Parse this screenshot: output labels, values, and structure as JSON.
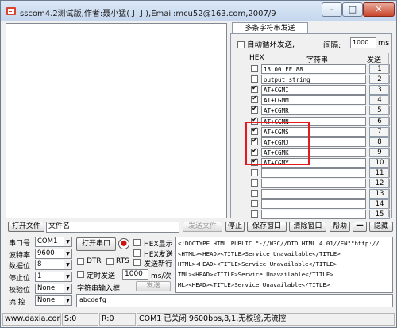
{
  "window": {
    "title": "sscom4.2测试版,作者:聂小猛(丁丁),Email:mcu52@163.com,2007/9",
    "minimize_glyph": "–",
    "maximize_glyph": "□",
    "close_glyph": "✕"
  },
  "multi_send": {
    "tab_label": "多条字符串发送",
    "auto_loop_label": "自动循环发送,",
    "interval_label": "间隔:",
    "interval_value": "1000",
    "interval_unit": "ms",
    "header_hex": "HEX",
    "header_string": "字符串",
    "header_send": "发送",
    "rows": [
      {
        "checked": false,
        "text": "13 00 FF 88",
        "num": "1"
      },
      {
        "checked": false,
        "text": "output string",
        "num": "2"
      },
      {
        "checked": true,
        "text": "AT+CGMI",
        "num": "3"
      },
      {
        "checked": true,
        "text": "AT+CGMM",
        "num": "4"
      },
      {
        "checked": true,
        "text": "AT+CGMR",
        "num": "5"
      },
      {
        "checked": true,
        "text": "AT+CGMN",
        "num": "6"
      },
      {
        "checked": true,
        "text": "AT+CGMS",
        "num": "7"
      },
      {
        "checked": true,
        "text": "AT+CGMJ",
        "num": "8"
      },
      {
        "checked": true,
        "text": "AT+CGMK",
        "num": "9"
      },
      {
        "checked": true,
        "text": "AT+CGMY",
        "num": "10"
      },
      {
        "checked": false,
        "text": "",
        "num": "11"
      },
      {
        "checked": false,
        "text": "",
        "num": "12"
      },
      {
        "checked": false,
        "text": "",
        "num": "13"
      },
      {
        "checked": false,
        "text": "",
        "num": "14"
      },
      {
        "checked": false,
        "text": "",
        "num": "15"
      }
    ]
  },
  "toolbar": {
    "open_file": "打开文件",
    "filename": "文件名",
    "send_file": "发送文件",
    "stop": "停止",
    "save_window": "保存窗口",
    "clear_window": "清除窗口",
    "help": "帮助",
    "dash": "一",
    "hide": "隐藏"
  },
  "port": {
    "port_label": "串口号",
    "port_value": "COM1",
    "baud_label": "波特率",
    "baud_value": "9600",
    "data_label": "数据位",
    "data_value": "8",
    "stop_label": "停止位",
    "stop_value": "1",
    "parity_label": "校验位",
    "parity_value": "None",
    "flow_label": "流 控",
    "flow_value": "None",
    "open_button": "打开串口",
    "hex_display": "HEX显示",
    "hex_send": "HEX发送",
    "dtr": "DTR",
    "rts": "RTS",
    "send_newline": "发送新行",
    "timed_send": "定时发送",
    "timed_value": "1000",
    "timed_unit": "ms/次",
    "string_input_label": "字符串输入框:",
    "send_button": "发送",
    "input_value": "abcdefg"
  },
  "log_lines": [
    "<!DOCTYPE HTML PUBLIC \"-//W3C//DTD HTML 4.01//EN\"\"http://",
    "<HTML><HEAD><TITLE>Service Unavailable</TITLE>",
    "HTML><HEAD><TITLE>Service Unavailable</TITLE>",
    "TML><HEAD><TITLE>Service Unavailable</TITLE>",
    "ML><HEAD><TITLE>Service Unavailable</TITLE>"
  ],
  "status": {
    "site": "www.daxia.cor",
    "s_count": "S:0",
    "r_count": "R:0",
    "com_status": "COM1 已关闭  9600bps,8,1,无校验,无流控"
  },
  "colors": {
    "highlight": "#e6191c"
  }
}
